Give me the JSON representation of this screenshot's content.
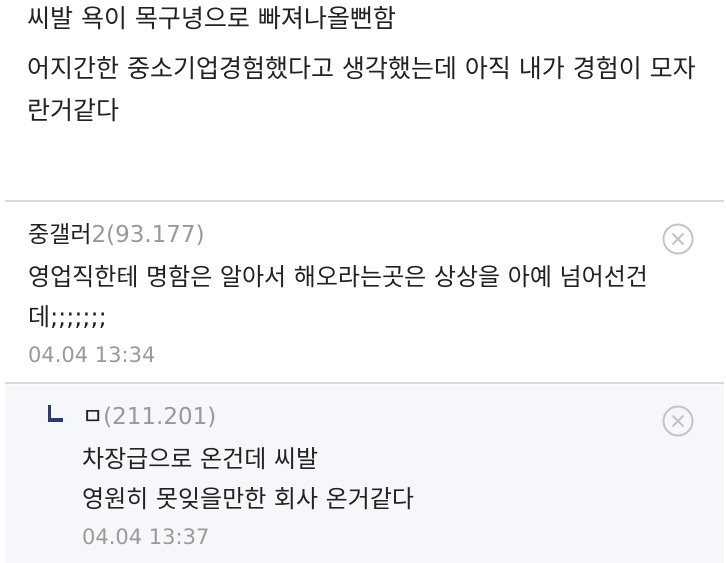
{
  "post": {
    "title_line": "씨발 욕이 목구녕으로 빠져나올뻔함",
    "body_line": "어지간한 중소기업경험했다고 생각했는데 아직 내가 경험이 모자란거같다"
  },
  "comments": [
    {
      "nickname": "중갤러",
      "ip": "2(93.177)",
      "text": "영업직한테 명함은 알아서 해오라는곳은 상상을 아예 넘어선건데;;;;;;;",
      "date": "04.04 13:34",
      "delete_icon": "close-circle-icon"
    },
    {
      "nickname": "ㅁ",
      "ip": "(211.201)",
      "text_line1": "차장급으로 온건데 씨발",
      "text_line2": "영원히 못잊을만한 회사 온거같다",
      "date": "04.04 13:37",
      "delete_icon": "close-circle-icon",
      "reply_icon": "reply-arrow-icon"
    }
  ],
  "colors": {
    "divider": "#d9d9d9",
    "reply_background": "#f5f7fa",
    "meta_text": "#999999",
    "reply_icon": "#2b3a67"
  }
}
